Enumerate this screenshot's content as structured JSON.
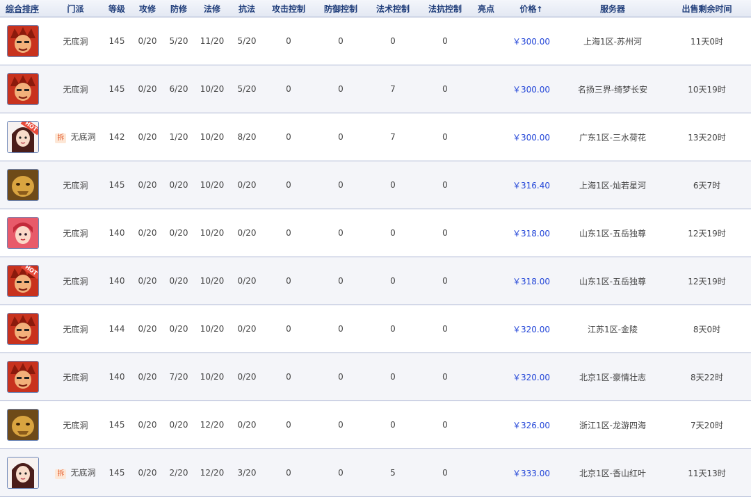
{
  "columns": {
    "rank": "综合排序",
    "school": "门派",
    "level": "等级",
    "atk": "攻修",
    "def": "防修",
    "mag": "法修",
    "res": "抗法",
    "atk_ctrl": "攻击控制",
    "def_ctrl": "防御控制",
    "mag_ctrl": "法术控制",
    "res_ctrl": "法抗控制",
    "highlight": "亮点",
    "price": "价格",
    "price_sort_icon": "↑",
    "server": "服务器",
    "time_left": "出售剩余时间"
  },
  "tag_label": "拆",
  "hot_label": "HOT",
  "colors": {
    "price": "#2346d8",
    "header_text": "#1f3d7a",
    "row_alt": "#f4f5f9"
  },
  "rows": [
    {
      "avatar": "red-demon-avatar",
      "hot": false,
      "tag": false,
      "school": "无底洞",
      "level": "145",
      "atk": "0/20",
      "def": "5/20",
      "mag": "11/20",
      "res": "5/20",
      "atk_ctrl": "0",
      "def_ctrl": "0",
      "mag_ctrl": "0",
      "res_ctrl": "0",
      "highlight": "",
      "price": "￥300.00",
      "server": "上海1区-苏州河",
      "time_left": "11天0时"
    },
    {
      "avatar": "red-demon-avatar",
      "hot": false,
      "tag": false,
      "school": "无底洞",
      "level": "145",
      "atk": "0/20",
      "def": "6/20",
      "mag": "10/20",
      "res": "5/20",
      "atk_ctrl": "0",
      "def_ctrl": "0",
      "mag_ctrl": "7",
      "res_ctrl": "0",
      "highlight": "",
      "price": "￥300.00",
      "server": "名扬三界-绮梦长安",
      "time_left": "10天19时"
    },
    {
      "avatar": "girl-avatar",
      "hot": true,
      "tag": true,
      "school": "无底洞",
      "level": "142",
      "atk": "0/20",
      "def": "1/20",
      "mag": "10/20",
      "res": "8/20",
      "atk_ctrl": "0",
      "def_ctrl": "0",
      "mag_ctrl": "7",
      "res_ctrl": "0",
      "highlight": "",
      "price": "￥300.00",
      "server": "广东1区-三水荷花",
      "time_left": "13天20时"
    },
    {
      "avatar": "golden-beast-avatar",
      "hot": false,
      "tag": false,
      "school": "无底洞",
      "level": "145",
      "atk": "0/20",
      "def": "0/20",
      "mag": "10/20",
      "res": "0/20",
      "atk_ctrl": "0",
      "def_ctrl": "0",
      "mag_ctrl": "0",
      "res_ctrl": "0",
      "highlight": "",
      "price": "￥316.40",
      "server": "上海1区-灿若星河",
      "time_left": "6天7时"
    },
    {
      "avatar": "pink-girl-avatar",
      "hot": false,
      "tag": false,
      "school": "无底洞",
      "level": "140",
      "atk": "0/20",
      "def": "0/20",
      "mag": "10/20",
      "res": "0/20",
      "atk_ctrl": "0",
      "def_ctrl": "0",
      "mag_ctrl": "0",
      "res_ctrl": "0",
      "highlight": "",
      "price": "￥318.00",
      "server": "山东1区-五岳独尊",
      "time_left": "12天19时"
    },
    {
      "avatar": "red-demon-avatar",
      "hot": true,
      "tag": false,
      "school": "无底洞",
      "level": "140",
      "atk": "0/20",
      "def": "0/20",
      "mag": "10/20",
      "res": "0/20",
      "atk_ctrl": "0",
      "def_ctrl": "0",
      "mag_ctrl": "0",
      "res_ctrl": "0",
      "highlight": "",
      "price": "￥318.00",
      "server": "山东1区-五岳独尊",
      "time_left": "12天19时"
    },
    {
      "avatar": "red-demon-avatar",
      "hot": false,
      "tag": false,
      "school": "无底洞",
      "level": "144",
      "atk": "0/20",
      "def": "0/20",
      "mag": "10/20",
      "res": "0/20",
      "atk_ctrl": "0",
      "def_ctrl": "0",
      "mag_ctrl": "0",
      "res_ctrl": "0",
      "highlight": "",
      "price": "￥320.00",
      "server": "江苏1区-金陵",
      "time_left": "8天0时"
    },
    {
      "avatar": "red-demon-avatar",
      "hot": false,
      "tag": false,
      "school": "无底洞",
      "level": "140",
      "atk": "0/20",
      "def": "7/20",
      "mag": "10/20",
      "res": "0/20",
      "atk_ctrl": "0",
      "def_ctrl": "0",
      "mag_ctrl": "0",
      "res_ctrl": "0",
      "highlight": "",
      "price": "￥320.00",
      "server": "北京1区-豪情壮志",
      "time_left": "8天22时"
    },
    {
      "avatar": "golden-beast-avatar",
      "hot": false,
      "tag": false,
      "school": "无底洞",
      "level": "145",
      "atk": "0/20",
      "def": "0/20",
      "mag": "12/20",
      "res": "0/20",
      "atk_ctrl": "0",
      "def_ctrl": "0",
      "mag_ctrl": "0",
      "res_ctrl": "0",
      "highlight": "",
      "price": "￥326.00",
      "server": "浙江1区-龙游四海",
      "time_left": "7天20时"
    },
    {
      "avatar": "girl-avatar",
      "hot": false,
      "tag": true,
      "school": "无底洞",
      "level": "145",
      "atk": "0/20",
      "def": "2/20",
      "mag": "12/20",
      "res": "3/20",
      "atk_ctrl": "0",
      "def_ctrl": "0",
      "mag_ctrl": "5",
      "res_ctrl": "0",
      "highlight": "",
      "price": "￥333.00",
      "server": "北京1区-香山红叶",
      "time_left": "11天13时"
    }
  ]
}
